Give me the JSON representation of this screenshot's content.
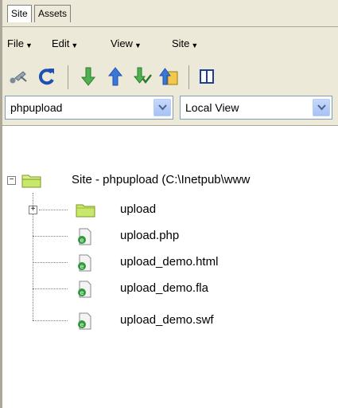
{
  "tabs": [
    {
      "label": "Site",
      "active": true
    },
    {
      "label": "Assets",
      "active": false
    }
  ],
  "menu": [
    {
      "label": "File"
    },
    {
      "label": "Edit"
    },
    {
      "label": "View"
    },
    {
      "label": "Site"
    }
  ],
  "toolbar": {
    "buttons": [
      "connect-icon",
      "refresh-icon",
      "get-icon",
      "put-icon",
      "check-out-icon",
      "check-in-icon",
      "expand-icon"
    ]
  },
  "site_select": {
    "value": "phpupload"
  },
  "view_select": {
    "value": "Local View"
  },
  "tree": {
    "root": {
      "label": "Site - phpupload (C:\\Inetpub\\www"
    },
    "items": [
      {
        "label": "upload",
        "type": "folder"
      },
      {
        "label": "upload.php",
        "type": "file"
      },
      {
        "label": "upload_demo.html",
        "type": "file"
      },
      {
        "label": "upload_demo.fla",
        "type": "file"
      },
      {
        "label": "upload_demo.swf",
        "type": "file"
      }
    ]
  },
  "colors": {
    "chrome": "#ece9d8",
    "folder": "#c8e86b",
    "file_badge": "#2e9a3a",
    "arrow_green": "#3b9a3b"
  }
}
